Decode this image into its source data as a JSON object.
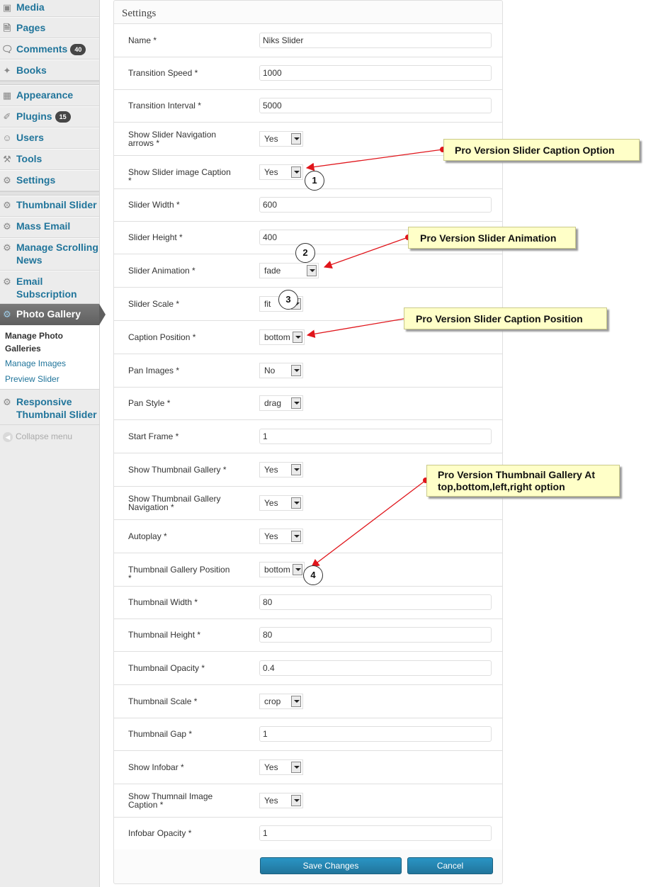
{
  "sidebar": {
    "items": [
      {
        "label": "Media",
        "icon": "media-icon"
      },
      {
        "label": "Pages",
        "icon": "pages-icon"
      },
      {
        "label": "Comments",
        "icon": "comments-icon",
        "badge": "40"
      },
      {
        "label": "Books",
        "icon": "pin-icon"
      },
      {
        "label": "Appearance",
        "icon": "appearance-icon"
      },
      {
        "label": "Plugins",
        "icon": "plugins-icon",
        "badge": "15"
      },
      {
        "label": "Users",
        "icon": "users-icon"
      },
      {
        "label": "Tools",
        "icon": "tools-icon"
      },
      {
        "label": "Settings",
        "icon": "settings-icon"
      },
      {
        "label": "Thumbnail Slider",
        "icon": "gear-icon"
      },
      {
        "label": "Mass Email",
        "icon": "gear-icon"
      },
      {
        "label": "Manage Scrolling News",
        "line1": "Manage Scrolling",
        "line2": "News",
        "icon": "gear-icon"
      },
      {
        "label": "Email Subscription",
        "line1": "Email",
        "line2": "Subscription",
        "icon": "gear-icon"
      },
      {
        "label": "Photo Gallery",
        "icon": "gear-icon"
      },
      {
        "label": "Responsive Thumbnail Slider",
        "line1": "Responsive",
        "line2": "Thumbnail Slider",
        "icon": "gear-icon"
      }
    ],
    "submenu": {
      "manage_photo_line1": "Manage Photo",
      "manage_photo_line2": "Galleries",
      "manage_images": "Manage Images",
      "preview_slider": "Preview Slider"
    },
    "collapse": "Collapse menu"
  },
  "panel": {
    "title": "Settings",
    "fields": [
      {
        "label": "Name *",
        "type": "text",
        "value": "Niks Slider"
      },
      {
        "label": "Transition Speed *",
        "type": "text",
        "value": "1000"
      },
      {
        "label": "Transition Interval *",
        "type": "text",
        "value": "5000"
      },
      {
        "label": "Show Slider Navigation arrows *",
        "line1": "Show Slider Navigation",
        "line2": "arrows *",
        "type": "select",
        "value": "Yes"
      },
      {
        "label": "Show Slider image Caption *",
        "type": "select",
        "value": "Yes"
      },
      {
        "label": "Slider Width *",
        "type": "text",
        "value": "600"
      },
      {
        "label": "Slider Height *",
        "type": "text",
        "value": "400"
      },
      {
        "label": "Slider Animation *",
        "type": "select",
        "value": "fade"
      },
      {
        "label": "Slider Scale *",
        "type": "select",
        "value": "fit"
      },
      {
        "label": "Caption Position *",
        "type": "select",
        "value": "bottom"
      },
      {
        "label": "Pan Images *",
        "type": "select",
        "value": "No"
      },
      {
        "label": "Pan Style *",
        "type": "select",
        "value": "drag"
      },
      {
        "label": "Start Frame *",
        "type": "text",
        "value": "1"
      },
      {
        "label": "Show Thumbnail Gallery *",
        "type": "select",
        "value": "Yes"
      },
      {
        "label": "Show Thumbnail Gallery Navigation *",
        "line1": "Show Thumbnail Gallery",
        "line2": "Navigation *",
        "type": "select",
        "value": "Yes"
      },
      {
        "label": "Autoplay *",
        "type": "select",
        "value": "Yes"
      },
      {
        "label": "Thumbnail Gallery Position *",
        "type": "select",
        "value": "bottom"
      },
      {
        "label": "Thumbnail Width *",
        "type": "text",
        "value": "80"
      },
      {
        "label": "Thumbnail Height *",
        "type": "text",
        "value": "80"
      },
      {
        "label": "Thumbnail Opacity *",
        "type": "text",
        "value": "0.4"
      },
      {
        "label": "Thumbnail Scale *",
        "type": "select",
        "value": "crop"
      },
      {
        "label": "Thumbnail Gap *",
        "type": "text",
        "value": "1"
      },
      {
        "label": "Show Infobar *",
        "type": "select",
        "value": "Yes"
      },
      {
        "label": "Show Thumnail Image Caption *",
        "line1": "Show Thumnail Image",
        "line2": "Caption *",
        "type": "select",
        "value": "Yes"
      },
      {
        "label": "Infobar Opacity *",
        "type": "text",
        "value": "1"
      }
    ],
    "save_label": "Save Changes",
    "cancel_label": "Cancel"
  },
  "annotations": {
    "callout1": "Pro Version Slider Caption Option",
    "callout2": "Pro Version Slider Animation",
    "callout3": "Pro Version Slider Caption Position",
    "callout4_line1": "Pro Version Thumbnail Gallery At",
    "callout4_line2": "top,bottom,left,right option",
    "num1": "1",
    "num2": "2",
    "num3": "3",
    "num4": "4",
    "arrow_color": "#e0151b",
    "callout_color": "#ffffc8"
  }
}
